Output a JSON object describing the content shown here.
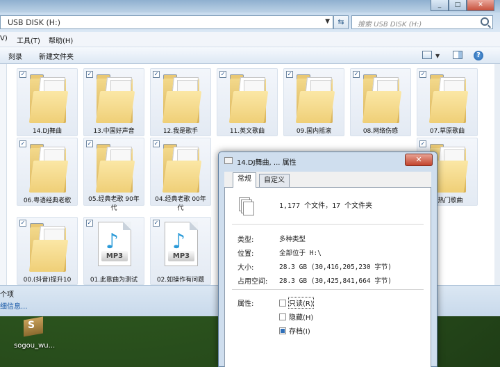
{
  "explorer": {
    "address": "USB DISK (H:)",
    "search_placeholder": "搜索 USB DISK (H:)",
    "menu": [
      "V)",
      "工具(T)",
      "帮助(H)"
    ],
    "toolbar": {
      "burn": "刻录",
      "new_folder": "新建文件夹"
    },
    "status_count": "个项",
    "status_link": "细信息...",
    "items": [
      {
        "label": "14.DJ舞曲",
        "type": "folder"
      },
      {
        "label": "13.中国好声音",
        "type": "folder"
      },
      {
        "label": "12.我是歌手",
        "type": "folder"
      },
      {
        "label": "11.英文歌曲",
        "type": "folder"
      },
      {
        "label": "09.国内摇滚",
        "type": "folder"
      },
      {
        "label": "08.网络伤感",
        "type": "folder"
      },
      {
        "label": "07.草原歌曲",
        "type": "folder"
      },
      {
        "label": "06.粤语经典老歌",
        "type": "folder"
      },
      {
        "label": "05.经典老歌 90年代",
        "type": "folder"
      },
      {
        "label": "04.经典老歌 00年代",
        "type": "folder"
      },
      {
        "label": "首热门歌曲",
        "type": "folder"
      },
      {
        "label": "00.(抖音)提升10",
        "type": "folder"
      },
      {
        "label": "01.此歌曲为测试",
        "type": "mp3"
      },
      {
        "label": "02.如操作有问题",
        "type": "mp3"
      }
    ],
    "mp3_tag": "MP3"
  },
  "desktop": {
    "icon_label": "sogou_wu..."
  },
  "dialog": {
    "title": "14.DJ舞曲, ... 属性",
    "close": "✕",
    "tabs": [
      "常规",
      "自定义"
    ],
    "summary": "1,177 个文件，17 个文件夹",
    "rows": [
      {
        "label": "类型:",
        "value": "多种类型"
      },
      {
        "label": "位置:",
        "value": "全部位于 H:\\"
      },
      {
        "label": "大小:",
        "value": "28.3 GB (30,416,205,230 字节)"
      },
      {
        "label": "占用空间:",
        "value": "28.3 GB (30,425,841,664 字节)"
      }
    ],
    "attributes_label": "属性:",
    "attributes": [
      {
        "label": "只读(R)",
        "checked": false
      },
      {
        "label": "隐藏(H)",
        "checked": false
      },
      {
        "label": "存档(I)",
        "checked": true
      }
    ]
  }
}
